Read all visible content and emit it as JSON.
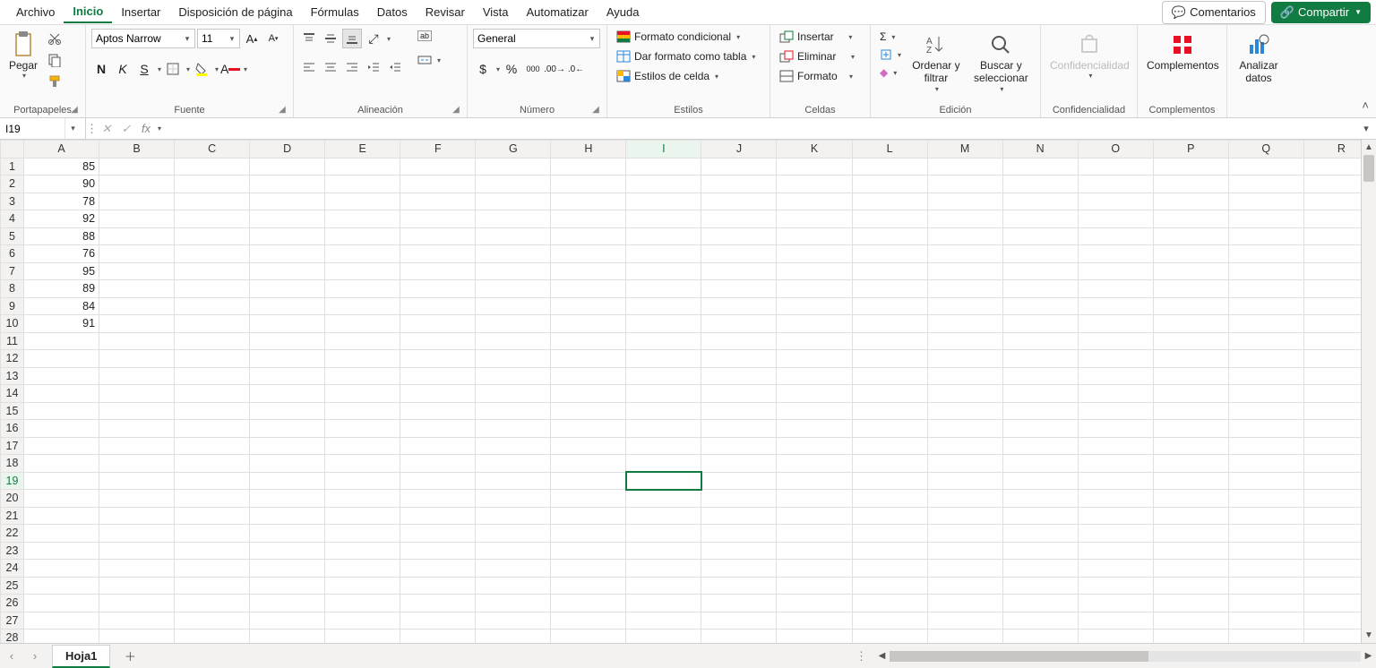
{
  "menu": {
    "tabs": [
      "Archivo",
      "Inicio",
      "Insertar",
      "Disposición de página",
      "Fórmulas",
      "Datos",
      "Revisar",
      "Vista",
      "Automatizar",
      "Ayuda"
    ],
    "active": "Inicio",
    "comments": "Comentarios",
    "share": "Compartir"
  },
  "ribbon": {
    "clipboard": {
      "paste": "Pegar",
      "label": "Portapapeles"
    },
    "font": {
      "name": "Aptos Narrow",
      "size": "11",
      "bold": "N",
      "italic": "K",
      "underline": "S",
      "label": "Fuente"
    },
    "alignment": {
      "wrap": "ab",
      "label": "Alineación"
    },
    "number": {
      "format": "General",
      "currency": "$",
      "percent": "%",
      "thousands": "000",
      "inc": "←0",
      "dec": "→0",
      "label": "Número"
    },
    "styles": {
      "cond": "Formato condicional",
      "table": "Dar formato como tabla",
      "cell": "Estilos de celda",
      "label": "Estilos"
    },
    "cells": {
      "insert": "Insertar",
      "delete": "Eliminar",
      "format": "Formato",
      "label": "Celdas"
    },
    "editing": {
      "sort": "Ordenar y filtrar",
      "find": "Buscar y seleccionar",
      "label": "Edición"
    },
    "sensitivity": {
      "btn": "Confidencialidad",
      "label": "Confidencialidad"
    },
    "addins": {
      "btn": "Complementos",
      "label": "Complementos"
    },
    "analyze": {
      "btn": "Analizar datos"
    }
  },
  "formula": {
    "namebox": "I19"
  },
  "grid": {
    "columns": [
      "A",
      "B",
      "C",
      "D",
      "E",
      "F",
      "G",
      "H",
      "I",
      "J",
      "K",
      "L",
      "M",
      "N",
      "O",
      "P",
      "Q",
      "R"
    ],
    "rows": 28,
    "active": {
      "col": "I",
      "row": 19
    },
    "data": {
      "A1": "85",
      "A2": "90",
      "A3": "78",
      "A4": "92",
      "A5": "88",
      "A6": "76",
      "A7": "95",
      "A8": "89",
      "A9": "84",
      "A10": "91"
    }
  },
  "sheets": {
    "active": "Hoja1"
  }
}
